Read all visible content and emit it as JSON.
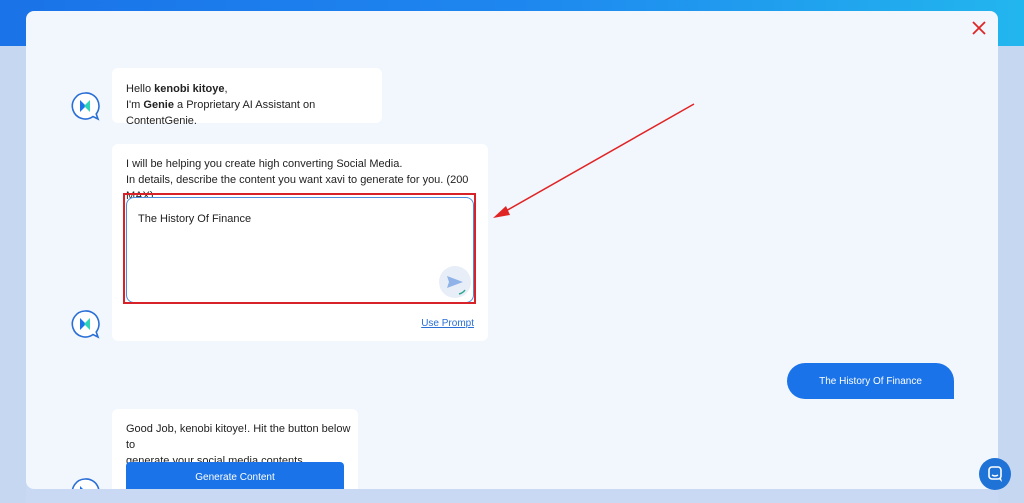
{
  "greeting": {
    "hello": "Hello",
    "user_name": "kenobi kitoye",
    "comma": ",",
    "im": "I'm",
    "assistant_name": "Genie",
    "assistant_desc": "a Proprietary AI Assistant on ContentGenie."
  },
  "prompt_bubble": {
    "line1": "I will be helping you create high converting Social Media.",
    "line2": "In details, describe the content you want xavi to generate for you. (200 MAX)",
    "input_value": "The History Of Finance",
    "use_prompt_label": "Use Prompt"
  },
  "user_message": {
    "text": "The History Of Finance"
  },
  "result_bubble": {
    "line1": "Good Job, kenobi kitoye!. Hit the button below to",
    "line2": "generate your social media contents",
    "button_label": "Generate Content"
  },
  "colors": {
    "accent": "#1a73e8",
    "annotation_red": "#d8222a"
  },
  "icons": [
    "close-icon",
    "genie-avatar-icon",
    "send-icon",
    "chat-icon"
  ]
}
